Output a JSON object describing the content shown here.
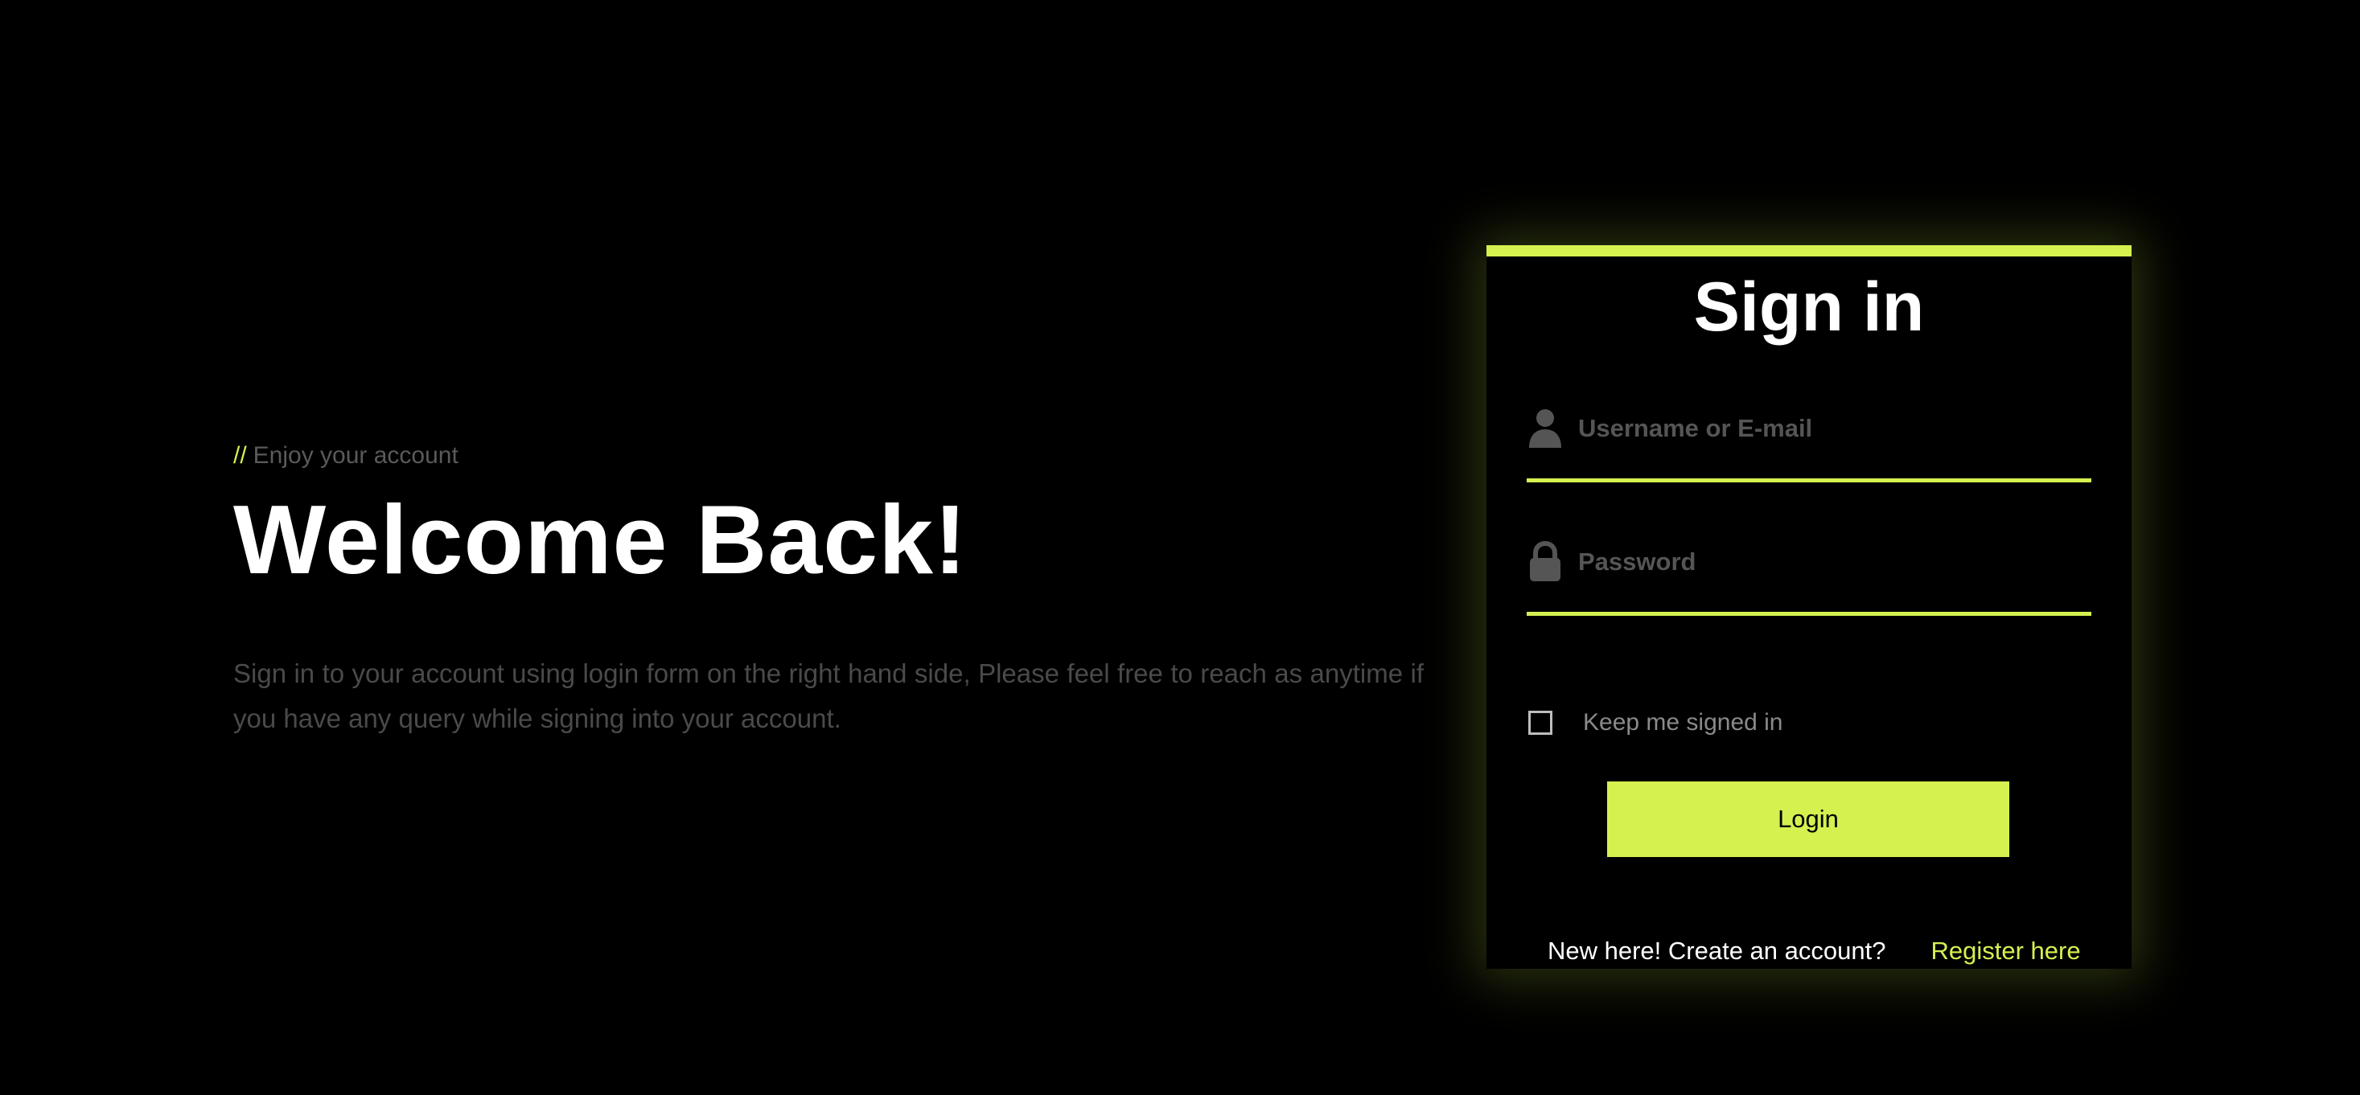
{
  "hero": {
    "eyebrow_prefix": "//",
    "eyebrow_text": "Enjoy your account",
    "title": "Welcome Back!",
    "description": "Sign in to your account using login form on the right hand side, Please feel free to reach as anytime if you have any query while signing into your account."
  },
  "login": {
    "title": "Sign in",
    "username": {
      "placeholder": "Username or E-mail",
      "value": "",
      "icon": "user-icon"
    },
    "password": {
      "placeholder": "Password",
      "value": "",
      "icon": "lock-icon"
    },
    "remember_label": "Keep me signed in",
    "remember_checked": false,
    "submit_label": "Login",
    "register_prompt": "New here! Create an account?",
    "register_link": "Register here"
  },
  "colors": {
    "accent": "#d4f150",
    "background": "#000000",
    "muted_text": "#4a4a4a"
  }
}
